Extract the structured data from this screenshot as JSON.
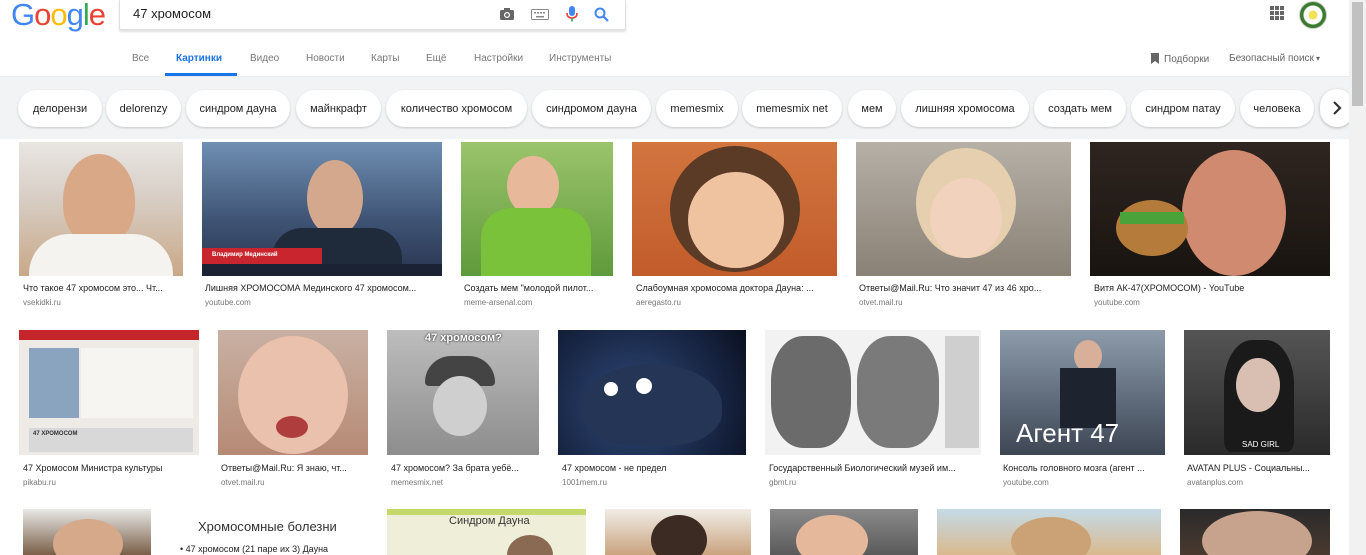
{
  "logo": {
    "letters": [
      "G",
      "o",
      "o",
      "g",
      "l",
      "e"
    ],
    "colors": [
      "#4285F4",
      "#EA4335",
      "#FBBC05",
      "#4285F4",
      "#34A853",
      "#EA4335"
    ]
  },
  "search": {
    "value": "47 хромосом"
  },
  "tabs": [
    "Все",
    "Картинки",
    "Видео",
    "Новости",
    "Карты",
    "Ещё",
    "Настройки",
    "Инструменты"
  ],
  "active_tab": "Картинки",
  "right_tools": {
    "collections": "Подборки",
    "safe_search": "Безопасный поиск"
  },
  "chips": [
    "делорензи",
    "delorenzy",
    "синдром дауна",
    "майнкрафт",
    "количество хромосом",
    "синдромом дауна",
    "memesmix",
    "memesmix net",
    "мем",
    "лишняя хромосома",
    "создать мем",
    "синдром патау",
    "человека"
  ],
  "row1": [
    {
      "caption": "Что такое 47 хромосом это... Чт...",
      "domain": "vsekidki.ru",
      "color": "#c9a888"
    },
    {
      "caption": "Лишняя ХРОМОСОМА Мединского 47 хромосом...",
      "domain": "youtube.com",
      "color": "#4a5f82",
      "overlay": "Владимир Мединский"
    },
    {
      "caption": "Создать мем \"молодой пилот...",
      "domain": "meme-arsenal.com",
      "color": "#7fbf3a"
    },
    {
      "caption": "Слабоумная хромосома доктора Дауна: ...",
      "domain": "aeregasto.ru",
      "color": "#c56b3f"
    },
    {
      "caption": "Ответы@Mail.Ru: Что значит 47 из 46 хро...",
      "domain": "otvet.mail.ru",
      "color": "#b7a18a"
    },
    {
      "caption": "Витя АК-47(ХРОМОСОМ) - YouTube",
      "domain": "youtube.com",
      "color": "#6e4c38"
    }
  ],
  "row2": [
    {
      "caption": "47 Хромосом Министра культуры",
      "domain": "pikabu.ru",
      "color": "#d7d2cf",
      "overlay": "47 ХРОМОСОМ"
    },
    {
      "caption": "Ответы@Mail.Ru: Я знаю, чт...",
      "domain": "otvet.mail.ru",
      "color": "#c89f8e"
    },
    {
      "caption": "47 хромосом? За брата уебё...",
      "domain": "memesmix.net",
      "color": "#9a9a9a",
      "overlay": "47 хромосом?"
    },
    {
      "caption": "47 хромосом - не предел",
      "domain": "1001mem.ru",
      "color": "#1b2a4a"
    },
    {
      "caption": "Государственный Биологический музей им...",
      "domain": "gbmt.ru",
      "color": "#8c8c8c"
    },
    {
      "caption": "Консоль головного мозга (агент ...",
      "domain": "youtube.com",
      "color": "#5a6675",
      "overlay": "Агент 47"
    },
    {
      "caption": "AVATAN PLUS - Социальны...",
      "domain": "avatanplus.com",
      "color": "#3c3c3c",
      "overlay": "SAD GIRL"
    }
  ],
  "row3": [
    {
      "color": "#7a5e48"
    },
    {
      "color": "#ffffff",
      "overlay": "Хромосомные болезни",
      "overlay2": "• 47 хромосом (21 паре их 3) Дауна"
    },
    {
      "color": "#e9e6c8",
      "overlay": "Синдром Дауна"
    },
    {
      "color": "#c9a37e"
    },
    {
      "color": "#b58c6a"
    },
    {
      "color": "#d9b98d"
    },
    {
      "color": "#b08f77"
    }
  ]
}
